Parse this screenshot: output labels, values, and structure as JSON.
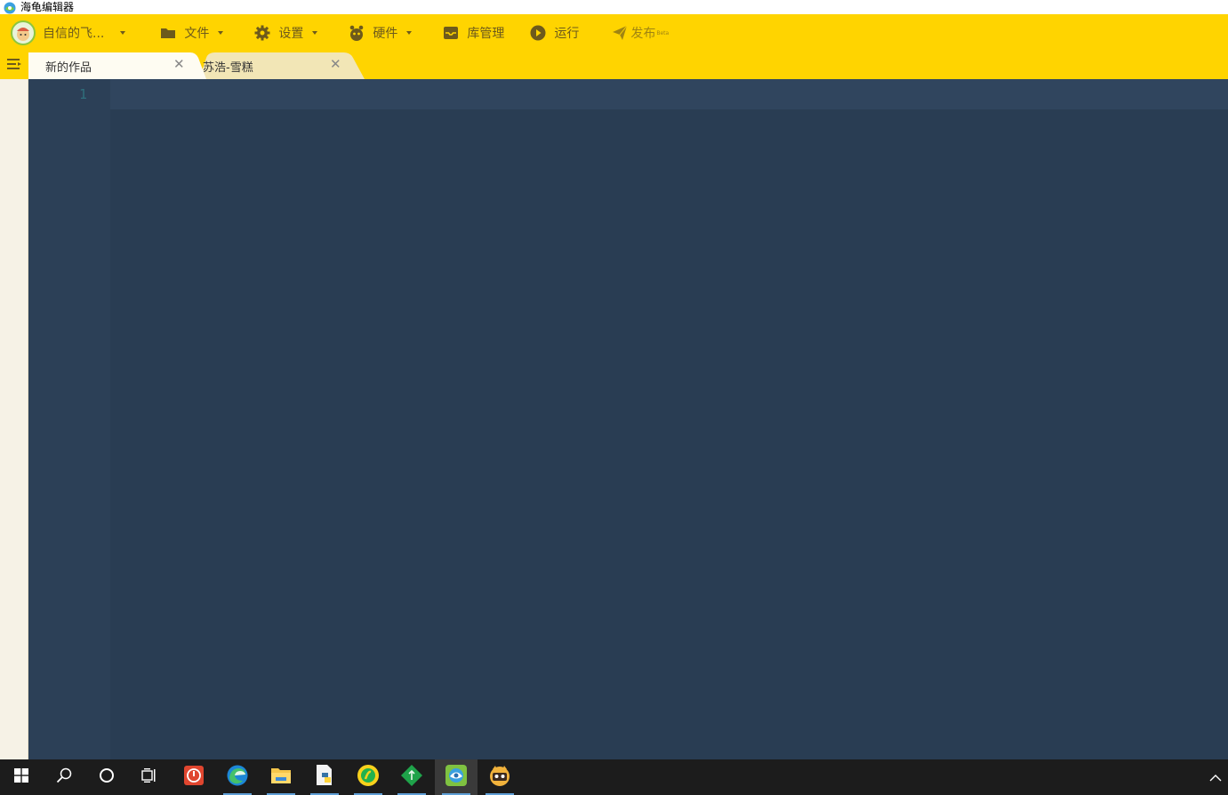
{
  "window": {
    "title": "海龟编辑器"
  },
  "toolbar": {
    "user_label": "自信的飞...",
    "file_label": "文件",
    "settings_label": "设置",
    "hardware_label": "硬件",
    "library_label": "库管理",
    "run_label": "运行",
    "publish_label": "发布",
    "publish_badge": "Beta"
  },
  "tabs": [
    {
      "label": "新的作品",
      "active": true
    },
    {
      "label": "苏浩-雪糕",
      "active": false
    }
  ],
  "editor": {
    "line_numbers": [
      "1"
    ]
  },
  "colors": {
    "toolbar_bg": "#ffd400",
    "editor_bg": "#2a3e55",
    "toolbar_text": "#6d5a1c",
    "taskbar_bg": "#1c1c1c"
  },
  "taskbar": {
    "items": [
      "start-icon",
      "search-icon",
      "cortana-icon",
      "task-view-icon",
      "app-red-icon",
      "edge-icon",
      "file-explorer-icon",
      "python-file-icon",
      "music-icon",
      "green-diamond-icon",
      "turtle-editor-icon",
      "cat-app-icon"
    ],
    "active_item": "turtle-editor-icon"
  }
}
